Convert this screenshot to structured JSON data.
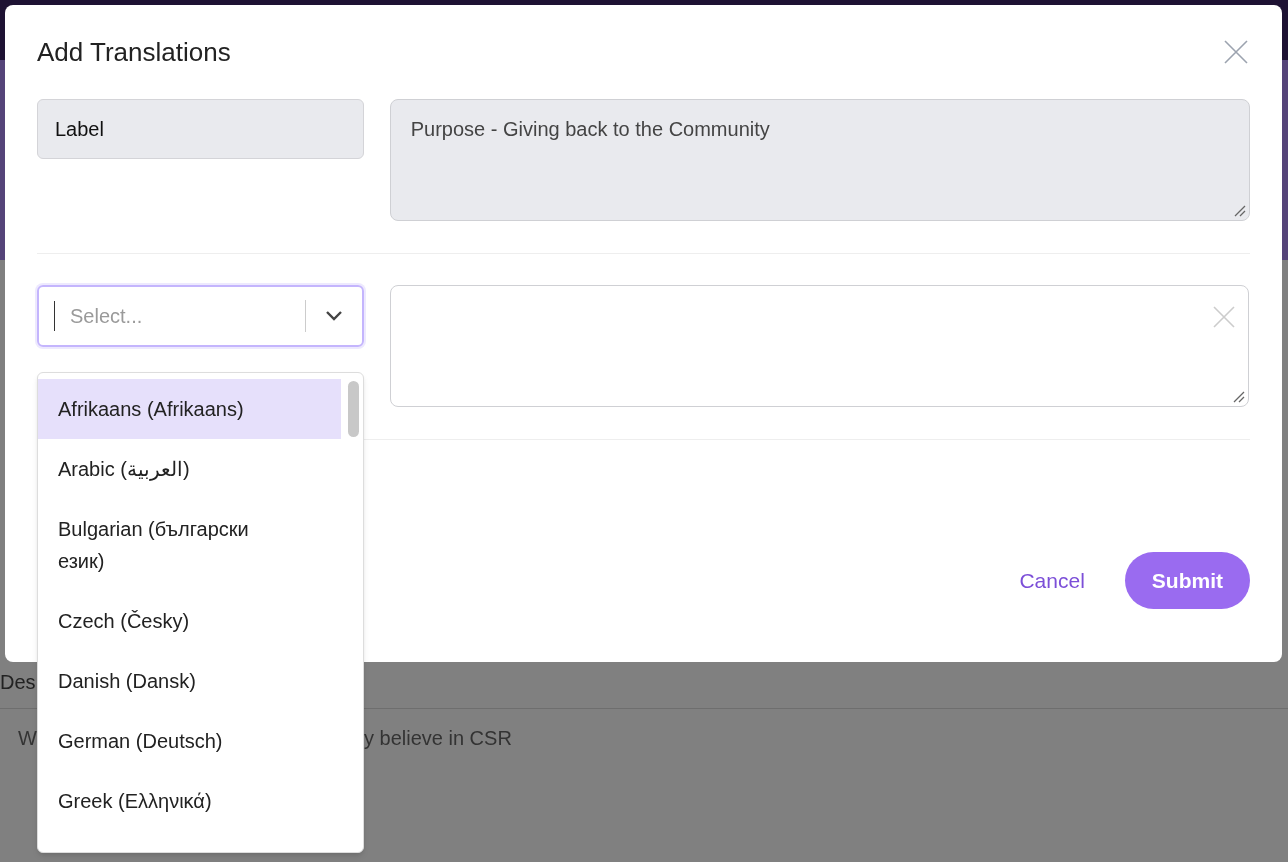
{
  "background": {
    "texts": [
      "Des",
      "W",
      "y believe in CSR"
    ]
  },
  "dialog": {
    "title": "Add Translations",
    "label_field": {
      "value": "Label"
    },
    "label_text": {
      "value": "Purpose - Giving back to the Community"
    },
    "language_select": {
      "placeholder": "Select...",
      "expanded": true,
      "options": [
        {
          "label": "Afrikaans (Afrikaans)",
          "selected": true
        },
        {
          "label": "Arabic (العربية)",
          "selected": false
        },
        {
          "label": "Bulgarian (български език)",
          "selected": false
        },
        {
          "label": "Czech (Česky)",
          "selected": false
        },
        {
          "label": "Danish (Dansk)",
          "selected": false
        },
        {
          "label": "German (Deutsch)",
          "selected": false
        },
        {
          "label": "Greek (Ελληνικά)",
          "selected": false
        }
      ]
    },
    "buttons": [
      {
        "label": "Cancel",
        "kind": "link"
      },
      {
        "label": "Submit",
        "kind": "primary"
      }
    ]
  }
}
